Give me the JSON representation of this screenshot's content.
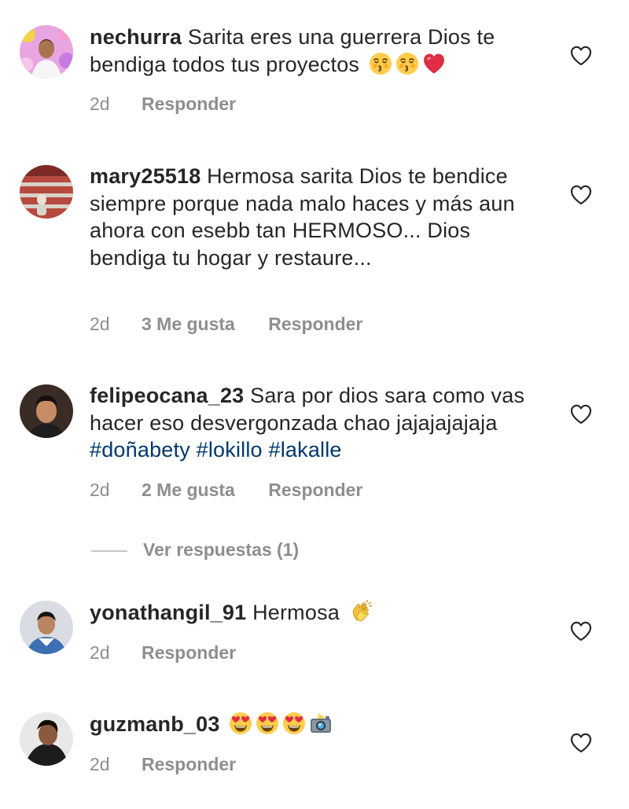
{
  "comments": [
    {
      "username": "nechurra",
      "text": "Sarita eres una guerrera Dios te bendiga todos tus proyectos",
      "emojis": [
        "kissing-face-icon",
        "kissing-face-icon",
        "red-heart-icon"
      ],
      "time": "2d",
      "likes": "",
      "reply": "Responder"
    },
    {
      "username": "mary25518",
      "text": "Hermosa sarita Dios te bendice siempre porque nada malo haces y más aun ahora con esebb tan HERMOSO... Dios bendiga tu hogar y restaure...",
      "time": "2d",
      "likes": "3 Me gusta",
      "reply": "Responder"
    },
    {
      "username": "felipeocana_23",
      "text": "Sara por dios sara como vas hacer eso desvergonzada chao jajajajajaja",
      "hashtags": [
        "#doñabety",
        "#lokillo",
        "#lakalle"
      ],
      "time": "2d",
      "likes": "2 Me gusta",
      "reply": "Responder",
      "view_replies": "Ver respuestas (1)"
    },
    {
      "username": "yonathangil_91",
      "text": "Hermosa",
      "emojis": [
        "clapping-hands-icon"
      ],
      "time": "2d",
      "likes": "",
      "reply": "Responder"
    },
    {
      "username": "guzmanb_03",
      "text": "",
      "emojis": [
        "heart-eyes-face-icon",
        "heart-eyes-face-icon",
        "heart-eyes-face-icon",
        "camera-flash-icon"
      ],
      "time": "2d",
      "likes": "",
      "reply": "Responder"
    }
  ],
  "colors": {
    "text": "#262626",
    "secondary": "#8e8e8e",
    "hashtag": "#00376b",
    "divider": "#c7c7c7"
  }
}
